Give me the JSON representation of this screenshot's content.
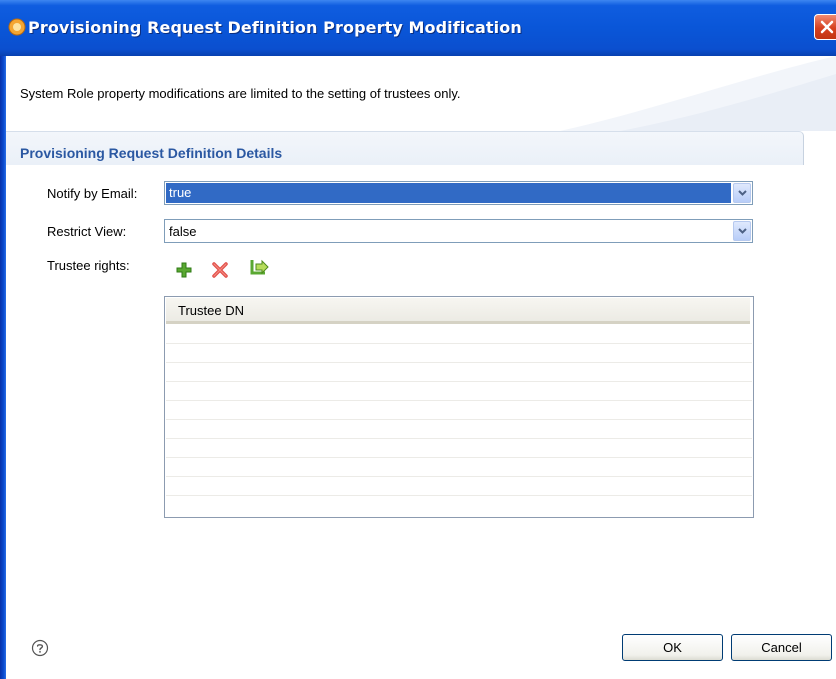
{
  "window": {
    "title": "Provisioning Request Definition Property Modification"
  },
  "message": "System Role property modifications are limited to the setting of trustees only.",
  "section": {
    "title": "Provisioning Request Definition Details"
  },
  "fields": {
    "notify_label": "Notify by Email:",
    "notify_value": "true",
    "restrict_label": "Restrict View:",
    "restrict_value": "false",
    "trustee_label": "Trustee rights:"
  },
  "toolbar": {
    "icons": [
      "add-icon",
      "delete-icon",
      "edit-icon"
    ]
  },
  "table": {
    "columns": [
      "Trustee DN"
    ],
    "rows": []
  },
  "buttons": {
    "ok": "OK",
    "cancel": "Cancel"
  },
  "colors": {
    "titlebar": "#0a56d8",
    "section_title": "#2b58a2",
    "selection": "#316ac5"
  }
}
